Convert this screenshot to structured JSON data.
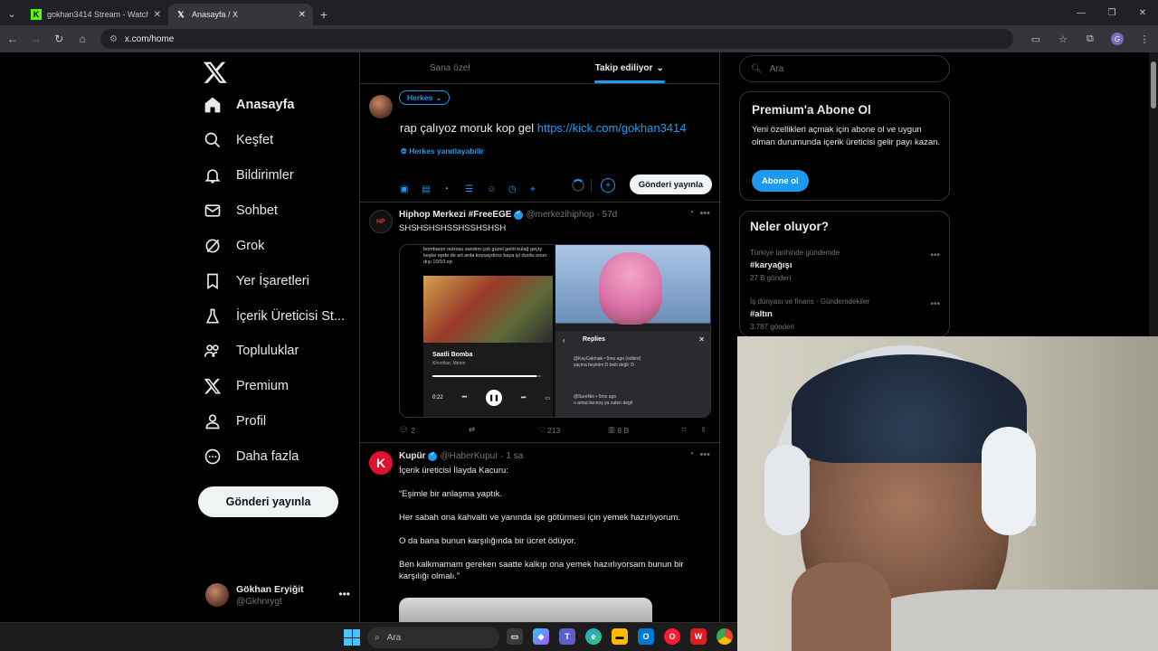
{
  "browser": {
    "tabs": [
      {
        "title": "gokhan3414 Stream - Watch Li",
        "favicon": "kick-icon",
        "active": false
      },
      {
        "title": "Anasayfa / X",
        "favicon": "x-icon",
        "active": true
      }
    ],
    "new_tab": "+",
    "url": "x.com/home"
  },
  "nav": {
    "items": [
      {
        "label": "Anasayfa",
        "icon": "home-icon",
        "active": true
      },
      {
        "label": "Keşfet",
        "icon": "search-icon"
      },
      {
        "label": "Bildirimler",
        "icon": "bell-icon"
      },
      {
        "label": "Sohbet",
        "icon": "mail-icon"
      },
      {
        "label": "Grok",
        "icon": "grok-icon"
      },
      {
        "label": "Yer İşaretleri",
        "icon": "bookmark-icon"
      },
      {
        "label": "İçerik Üreticisi St...",
        "icon": "flask-icon"
      },
      {
        "label": "Topluluklar",
        "icon": "people-icon"
      },
      {
        "label": "Premium",
        "icon": "x-icon"
      },
      {
        "label": "Profil",
        "icon": "person-icon"
      },
      {
        "label": "Daha fazla",
        "icon": "more-circle-icon"
      }
    ],
    "post_button": "Gönderi yayınla",
    "account": {
      "name": "Gökhan Eryiğit",
      "handle": "@Gkhnrygt"
    }
  },
  "timeline": {
    "tabs": [
      {
        "label": "Sana özel"
      },
      {
        "label": "Takip ediliyor",
        "active": true
      }
    ],
    "composer": {
      "audience": "Herkes",
      "text": "rap çalıyoz moruk kop gel ",
      "link": "https://kick.com/gokhan3414",
      "reply_setting": "Herkes yanıtlayabilir",
      "submit": "Gönderi yayınla"
    },
    "posts": [
      {
        "name": "Hiphop Merkezi #FreeEGE",
        "handle": "@merkezihiphop",
        "time": "57d",
        "text": "SHSHSHSHSSHSSHSHSH",
        "media": {
          "top_text": "bombanın outrosu sandım çok güzel geldi kulağ geçiş keşke epde de art arda koysaydınız baya iyi durdu onun dışı 10/10 ep",
          "song": "Saatli Bomba",
          "artist": "Khontkar, Metrin",
          "time": "0:22",
          "replies_title": "Replies",
          "comment1_user": "@KayCakmak • 5mo ago (edited)",
          "comment1": "saçma beyinim:D belli değil :D",
          "comment2_user": "@SureNin • 5mo ago",
          "comment2": "o amacılarımış ya zaten degil"
        },
        "replies": "2",
        "likes": "213",
        "views": "8 B"
      },
      {
        "name": "Kupür",
        "handle": "@HaberKupur",
        "time": "1 sa",
        "lines": [
          "İçerik üreticisi İlayda Kacuru:",
          "“Eşimle bir anlaşma yaptık.",
          "Her sabah ona kahvaltı ve yanında işe götürmesi için yemek hazırlıyorum.",
          "O da bana bunun karşılığında bir ücret ödüyor.",
          "Ben kalkmamam gereken saatte kalkıp ona yemek hazırlıyorsam bunun bir karşılığı olmalı.”"
        ]
      }
    ]
  },
  "right": {
    "search_placeholder": "Ara",
    "premium": {
      "title": "Premium'a Abone Ol",
      "desc": "Yeni özellikleri açmak için abone ol ve uygun olman durumunda içerik üreticisi gelir payı kazan.",
      "button": "Abone ol"
    },
    "trends": {
      "title": "Neler oluyor?",
      "items": [
        {
          "context": "Türkiye tarihinde gündemde",
          "name": "#karyağışı",
          "posts": "27 B gönderi"
        },
        {
          "context": "İş dünyası ve finans · Gündemdekiler",
          "name": "#altın",
          "posts": "3.787 gönderi"
        }
      ]
    }
  },
  "taskbar": {
    "search": "Ara"
  },
  "colors": {
    "accent": "#1d9bf0",
    "background": "#000000",
    "border": "#2f3336"
  }
}
